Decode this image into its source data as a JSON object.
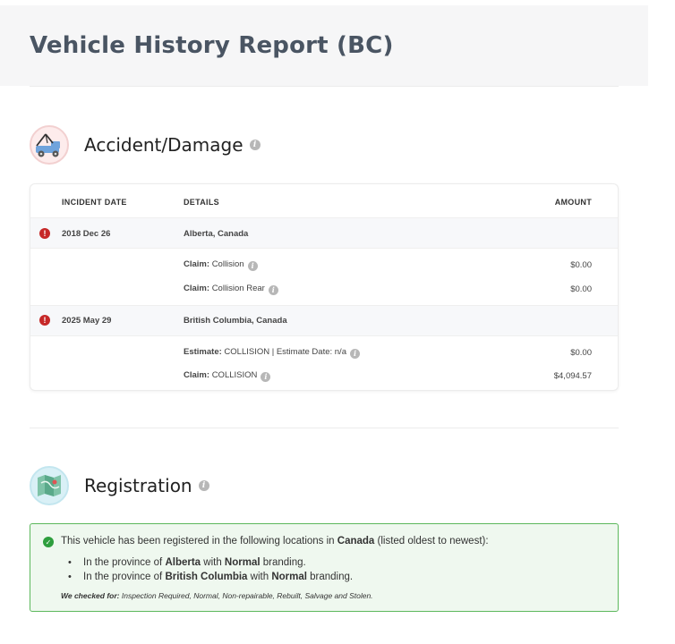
{
  "header": {
    "title": "Vehicle History Report (BC)"
  },
  "accident": {
    "title": "Accident/Damage",
    "columns": {
      "date": "INCIDENT DATE",
      "details": "DETAILS",
      "amount": "AMOUNT"
    },
    "incidents": [
      {
        "date": "2018 Dec 26",
        "location": "Alberta, Canada",
        "items": [
          {
            "label": "Claim:",
            "value": "Collision",
            "amount": "$0.00"
          },
          {
            "label": "Claim:",
            "value": "Collision Rear",
            "amount": "$0.00"
          }
        ]
      },
      {
        "date": "2025 May 29",
        "location": "British Columbia, Canada",
        "items": [
          {
            "label": "Estimate:",
            "value": "COLLISION | Estimate Date: n/a",
            "amount": "$0.00"
          },
          {
            "label": "Claim:",
            "value": "COLLISION",
            "amount": "$4,094.57"
          }
        ]
      }
    ]
  },
  "registration": {
    "title": "Registration",
    "intro_pre": "This vehicle has been registered in the following locations in",
    "intro_country": "Canada",
    "intro_post": "(listed oldest to newest):",
    "entries": [
      {
        "pre": "In the province of",
        "province": "Alberta",
        "mid": "with",
        "branding": "Normal",
        "post": "branding."
      },
      {
        "pre": "In the province of",
        "province": "British Columbia",
        "mid": "with",
        "branding": "Normal",
        "post": "branding."
      }
    ],
    "checked_label": "We checked for:",
    "checked_value": "Inspection Required, Normal, Non-repairable, Rebuilt, Salvage and Stolen."
  },
  "icons": {
    "accident": "tow-truck-icon",
    "registration": "map-icon",
    "info": "info-icon",
    "alert": "alert-icon",
    "check": "check-icon"
  },
  "colors": {
    "title": "#4a5563",
    "alert": "#c62828",
    "success_border": "#5cb85c",
    "success_bg": "#eff8ef"
  }
}
